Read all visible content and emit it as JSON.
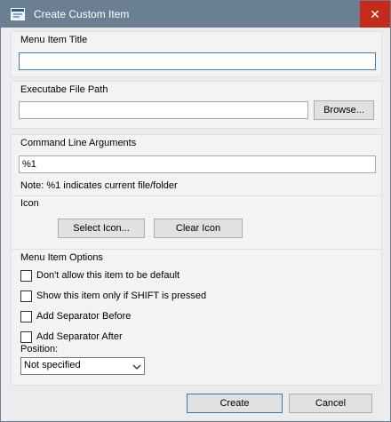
{
  "window": {
    "title": "Create Custom Item",
    "close_glyph": "✕"
  },
  "menu_item_title": {
    "label": "Menu Item Title",
    "value": ""
  },
  "executable_file_path": {
    "label": "Executabe File Path",
    "value": "",
    "browse_label": "Browse..."
  },
  "command_line_arguments": {
    "label": "Command Line Arguments",
    "value": "%1",
    "note": "Note: %1 indicates current file/folder"
  },
  "icon": {
    "label": "Icon",
    "select_label": "Select Icon...",
    "clear_label": "Clear Icon"
  },
  "menu_item_options": {
    "label": "Menu Item Options",
    "options": [
      {
        "label": "Don't allow this item to be default",
        "checked": false
      },
      {
        "label": "Show this item only if SHIFT is pressed",
        "checked": false
      },
      {
        "label": "Add Separator Before",
        "checked": false
      },
      {
        "label": "Add Separator After",
        "checked": false
      }
    ],
    "position_label": "Position:",
    "position_value": "Not specified"
  },
  "footer": {
    "create_label": "Create",
    "cancel_label": "Cancel"
  },
  "colors": {
    "titlebar": "#6b7f93",
    "close": "#c42b1c",
    "focus_border": "#3c7fb1"
  },
  "icons": {
    "app": "window-icon",
    "close": "close-icon",
    "dropdown": "chevron-down-icon"
  }
}
